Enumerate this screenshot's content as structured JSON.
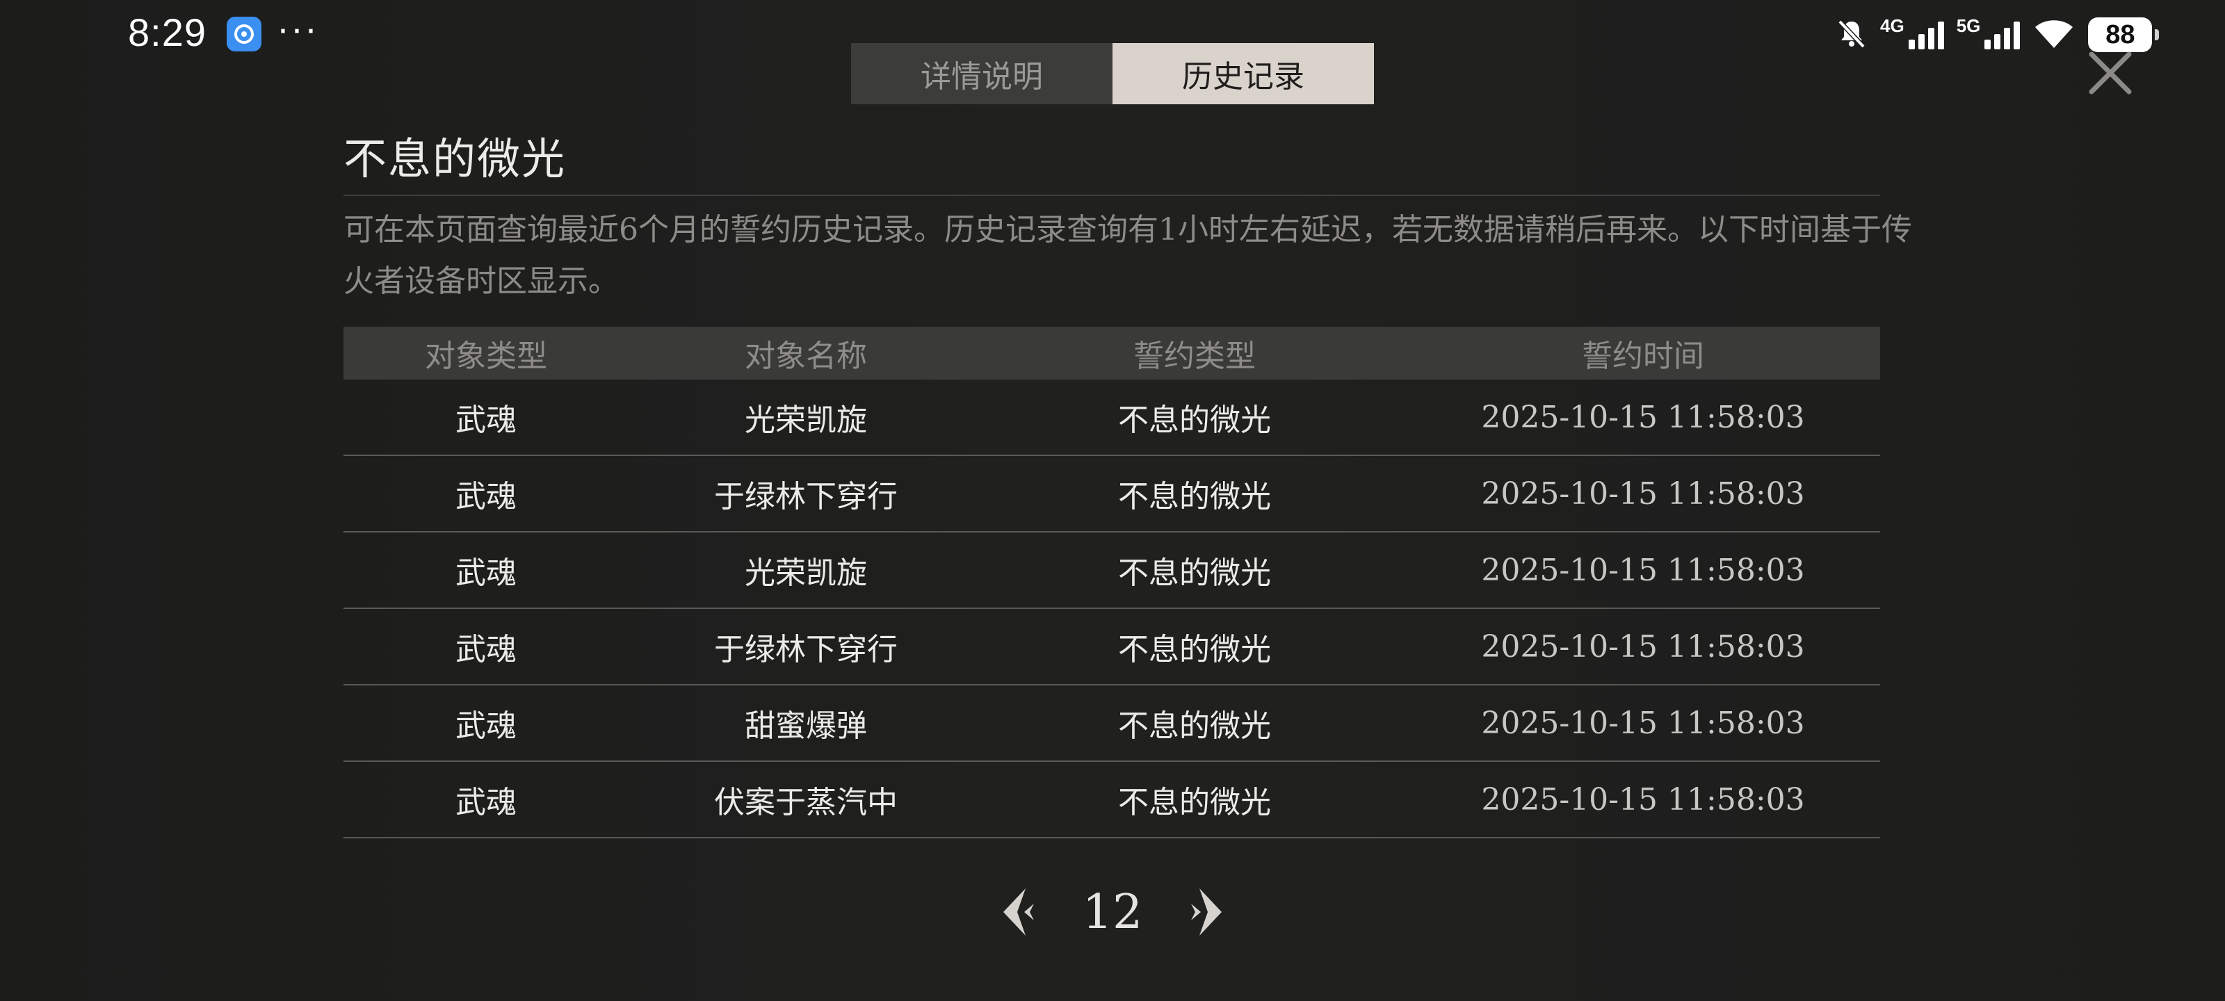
{
  "status_bar": {
    "time": "8:29",
    "more": "···",
    "net1": "4G",
    "net2": "5G",
    "battery": "88"
  },
  "tabs": [
    {
      "label": "详情说明",
      "active": false
    },
    {
      "label": "历史记录",
      "active": true
    }
  ],
  "title": "不息的微光",
  "description": "可在本页面查询最近6个月的誓约历史记录。历史记录查询有1小时左右延迟，若无数据请稍后再来。以下时间基于传火者设备时区显示。",
  "table": {
    "headers": [
      "对象类型",
      "对象名称",
      "誓约类型",
      "誓约时间"
    ],
    "rows": [
      [
        "武魂",
        "光荣凯旋",
        "不息的微光",
        "2025-10-15 11:58:03"
      ],
      [
        "武魂",
        "于绿林下穿行",
        "不息的微光",
        "2025-10-15 11:58:03"
      ],
      [
        "武魂",
        "光荣凯旋",
        "不息的微光",
        "2025-10-15 11:58:03"
      ],
      [
        "武魂",
        "于绿林下穿行",
        "不息的微光",
        "2025-10-15 11:58:03"
      ],
      [
        "武魂",
        "甜蜜爆弹",
        "不息的微光",
        "2025-10-15 11:58:03"
      ],
      [
        "武魂",
        "伏案于蒸汽中",
        "不息的微光",
        "2025-10-15 11:58:03"
      ]
    ]
  },
  "pagination": {
    "page": "12"
  },
  "icons": {
    "close": "close-icon",
    "prev": "prev-page-icon",
    "next": "next-page-icon"
  }
}
